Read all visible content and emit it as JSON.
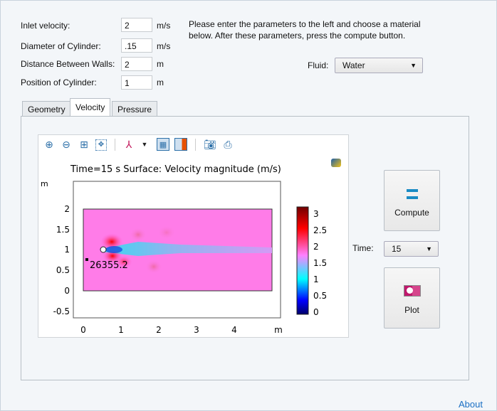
{
  "params": [
    {
      "label": "Inlet velocity:",
      "value": "2",
      "unit": "m/s"
    },
    {
      "label": "Diameter of Cylinder:",
      "value": ".15",
      "unit": "m/s"
    },
    {
      "label": "Distance Between Walls:",
      "value": "2",
      "unit": "m"
    },
    {
      "label": "Position of Cylinder:",
      "value": "1",
      "unit": "m"
    }
  ],
  "instructions": "Please enter the parameters to the left and choose a material below. After these parameters, press the compute button.",
  "fluid": {
    "label": "Fluid:",
    "value": "Water"
  },
  "tabs": [
    {
      "label": "Geometry"
    },
    {
      "label": "Velocity",
      "active": true
    },
    {
      "label": "Pressure"
    }
  ],
  "toolbar": [
    "zoom-in-icon",
    "zoom-out-icon",
    "zoom-box-icon",
    "zoom-extents-icon",
    "axes-orientation-icon",
    "grid-icon",
    "legend-icon",
    "camera-icon",
    "print-icon"
  ],
  "plot": {
    "title": "Time=15 s   Surface: Velocity magnitude (m/s)",
    "xunit": "m",
    "yunit": "m",
    "xticks": [
      "0",
      "1",
      "2",
      "3",
      "4"
    ],
    "yticks": [
      "2",
      "1.5",
      "1",
      "0.5",
      "0",
      "-0.5"
    ],
    "colorbar_ticks": [
      "3",
      "2.5",
      "2",
      "1.5",
      "1",
      "0.5",
      "0"
    ],
    "annotation": "26355.2",
    "colormap": [
      "#00006a",
      "#0000ff",
      "#00ffff",
      "#ff80ff",
      "#ff0000",
      "#700000"
    ]
  },
  "compute": {
    "label": "Compute"
  },
  "time": {
    "label": "Time:",
    "value": "15"
  },
  "plot_button": {
    "label": "Plot"
  },
  "about": "About",
  "accent": "#1a8bc4"
}
